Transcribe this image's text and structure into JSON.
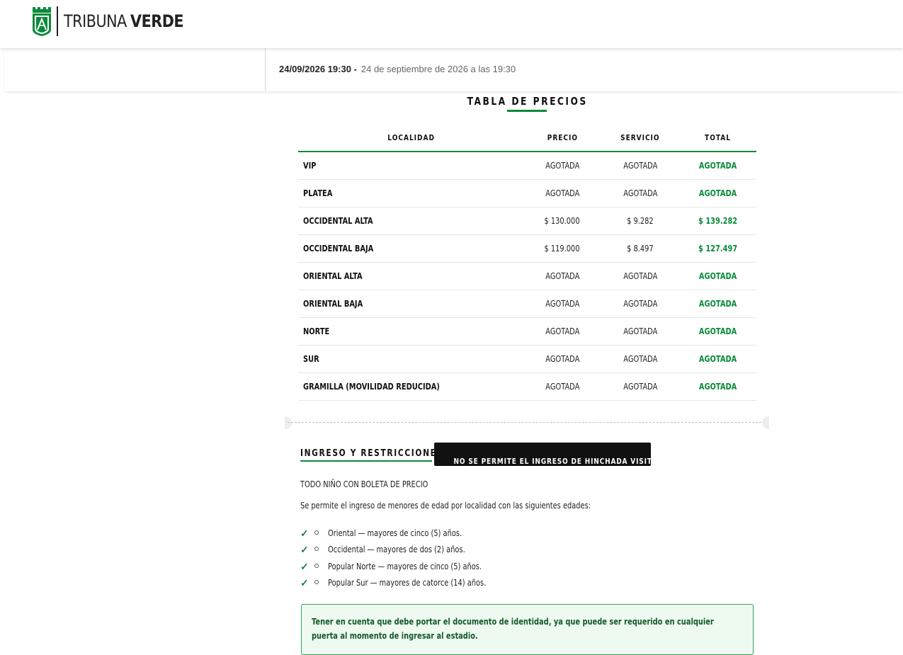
{
  "brand": {
    "name_light": "TRIBUNA",
    "name_bold": "VERDE",
    "logo_icon": "club-shield-icon",
    "accent_color": "#0a8a3a"
  },
  "event": {
    "date_short": "24/09/2026 19:30 -",
    "date_long": "24 de septiembre de 2026 a las 19:30"
  },
  "prices": {
    "title": "TABLA DE PRECIOS",
    "columns": [
      "LOCALIDAD",
      "PRECIO",
      "SERVICIO",
      "TOTAL"
    ],
    "rows": [
      {
        "localidad": "VIP",
        "precio": "AGOTADA",
        "servicio": "AGOTADA",
        "total": "AGOTADA"
      },
      {
        "localidad": "PLATEA",
        "precio": "AGOTADA",
        "servicio": "AGOTADA",
        "total": "AGOTADA"
      },
      {
        "localidad": "OCCIDENTAL ALTA",
        "precio": "$ 130.000",
        "servicio": "$ 9.282",
        "total": "$ 139.282"
      },
      {
        "localidad": "OCCIDENTAL BAJA",
        "precio": "$ 119.000",
        "servicio": "$ 8.497",
        "total": "$ 127.497"
      },
      {
        "localidad": "ORIENTAL ALTA",
        "precio": "AGOTADA",
        "servicio": "AGOTADA",
        "total": "AGOTADA"
      },
      {
        "localidad": "ORIENTAL BAJA",
        "precio": "AGOTADA",
        "servicio": "AGOTADA",
        "total": "AGOTADA"
      },
      {
        "localidad": "NORTE",
        "precio": "AGOTADA",
        "servicio": "AGOTADA",
        "total": "AGOTADA"
      },
      {
        "localidad": "SUR",
        "precio": "AGOTADA",
        "servicio": "AGOTADA",
        "total": "AGOTADA"
      },
      {
        "localidad": "GRAMILLA (MOVILIDAD REDUCIDA)",
        "precio": "AGOTADA",
        "servicio": "AGOTADA",
        "total": "AGOTADA"
      }
    ]
  },
  "ingreso": {
    "title": "INGRESO Y RESTRICCIONES",
    "badge": "NO SE PERMITE EL INGRESO DE HINCHADA VISITANTE",
    "p1": "TODO NIÑO CON BOLETA DE PRECIO",
    "p2": "Se permite el ingreso de menores de edad por localidad con las siguientes edades:",
    "check_icon": "check-icon",
    "items": [
      "Oriental — mayores de cinco (5) años.",
      "Occidental — mayores de dos (2) años.",
      "Popular Norte — mayores de cinco (5) años.",
      "Popular Sur — mayores de catorce (14) años."
    ],
    "notice": "Tener en cuenta que debe portar el documento de identidad, ya que puede ser requerido en cualquier puerta al momento de ingresar al estadio."
  }
}
